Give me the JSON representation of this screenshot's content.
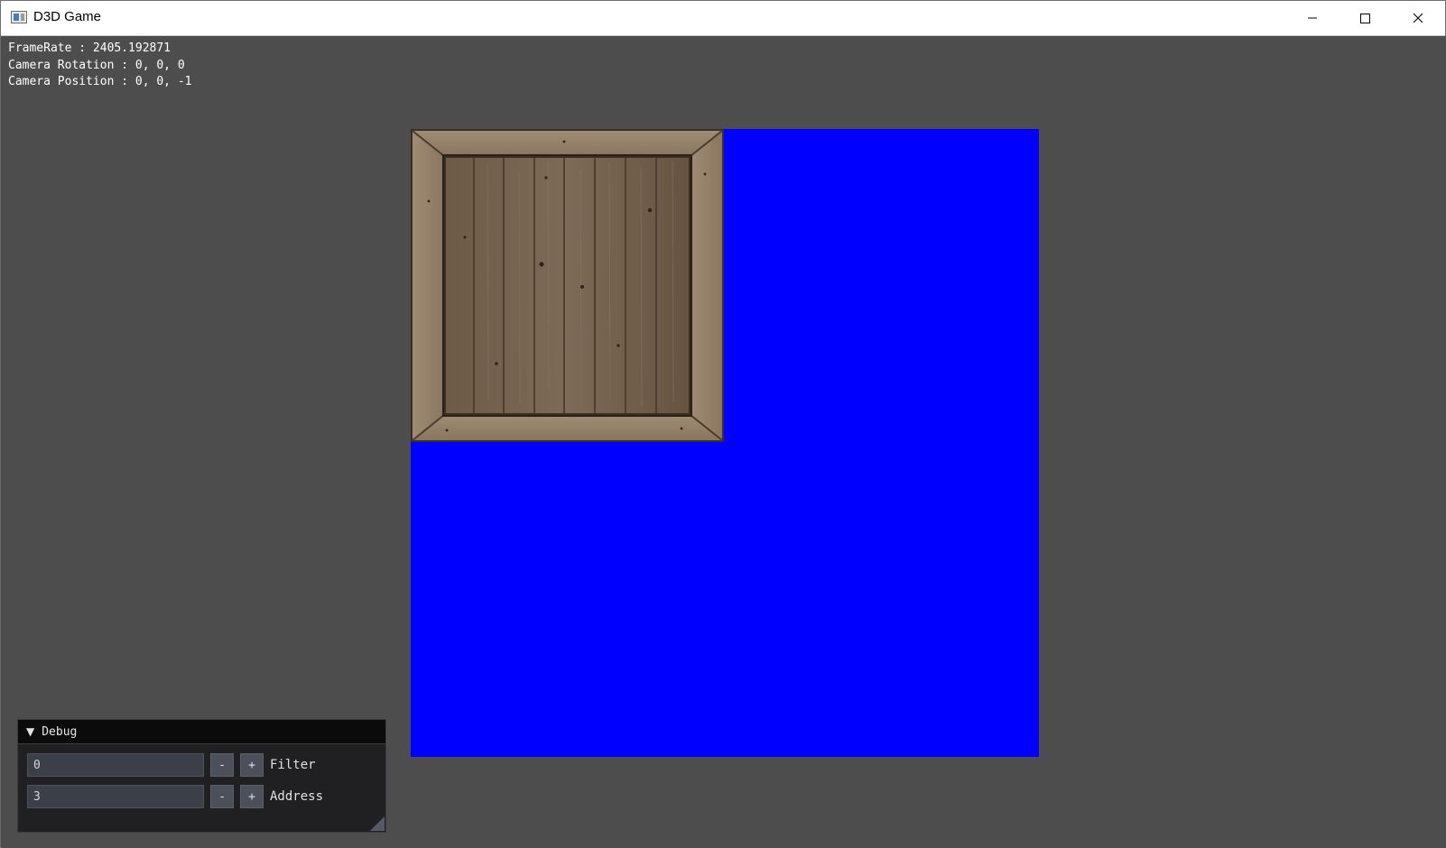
{
  "window": {
    "title": "D3D Game",
    "buttons": {
      "minimize_icon": "minimize-icon",
      "maximize_icon": "maximize-icon",
      "close_icon": "close-icon"
    }
  },
  "overlay": {
    "framerate": "FrameRate : 2405.192871",
    "camera_rotation": "Camera Rotation : 0, 0, 0",
    "camera_position": "Camera Position : 0, 0, -1"
  },
  "scene": {
    "quad_color": "#0000ff",
    "texture": "wooden-crate"
  },
  "debug": {
    "title": "Debug",
    "collapse_icon": "collapse-triangle-icon",
    "rows": [
      {
        "value": "0",
        "minus": "-",
        "plus": "+",
        "label": "Filter"
      },
      {
        "value": "3",
        "minus": "-",
        "plus": "+",
        "label": "Address"
      }
    ]
  }
}
